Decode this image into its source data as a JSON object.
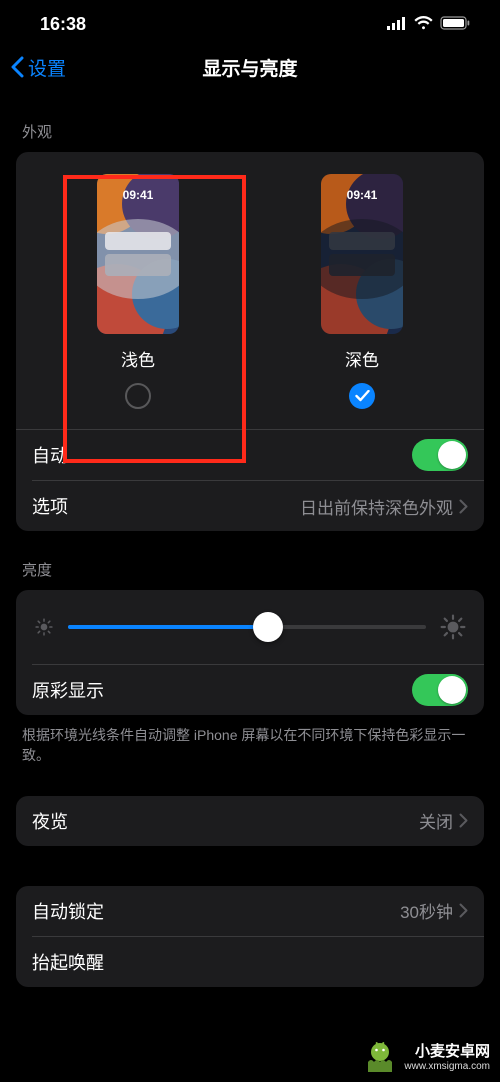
{
  "status": {
    "time": "16:38"
  },
  "nav": {
    "back": "设置",
    "title": "显示与亮度"
  },
  "appearance": {
    "header": "外观",
    "thumb_time": "09:41",
    "light_label": "浅色",
    "dark_label": "深色",
    "auto_label": "自动",
    "options_label": "选项",
    "options_value": "日出前保持深色外观"
  },
  "brightness": {
    "header": "亮度",
    "slider_value": 56,
    "truetone_label": "原彩显示",
    "truetone_note": "根据环境光线条件自动调整 iPhone 屏幕以在不同环境下保持色彩显示一致。"
  },
  "nightshift": {
    "label": "夜览",
    "value": "关闭"
  },
  "autolock": {
    "label": "自动锁定",
    "value": "30秒钟"
  },
  "raise": {
    "label": "抬起唤醒"
  },
  "watermark": {
    "line1": "小麦安卓网",
    "line2": "www.xmsigma.com"
  }
}
